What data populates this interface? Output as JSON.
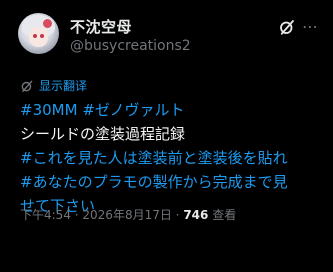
{
  "author": {
    "display_name": "不沈空母",
    "handle": "@busycreations2"
  },
  "translate_label": "显示翻译",
  "tweet": {
    "line1_tags": [
      "#30MM",
      "#ゼノヴァルト"
    ],
    "line2": "シールドの塗装過程記録",
    "line3": "#これを見た人は塗装前と塗装後を貼れ",
    "line4": "#あなたのプラモの製作から完成まで見",
    "line5": "せて下さい"
  },
  "meta": {
    "time": "下午4:54",
    "separator1": " · ",
    "date": "2026年8月17日",
    "separator2": " · ",
    "views": "746",
    "views_label": " 查看"
  },
  "icons": {
    "grok": "grok-slash-icon",
    "more": "more-icon",
    "translate": "translate-icon"
  },
  "colors": {
    "background": "#000000",
    "text": "#e7e9ea",
    "secondary": "#71767b",
    "accent": "#1d9bf0"
  }
}
